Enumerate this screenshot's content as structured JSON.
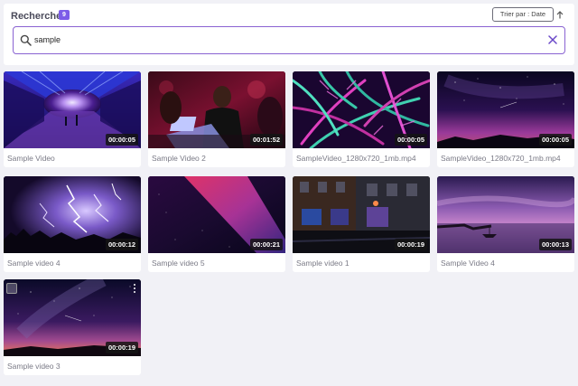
{
  "header": {
    "title": "Recherche",
    "count": "9",
    "sort_label": "Trier par : Date"
  },
  "search": {
    "value": "sample",
    "placeholder": ""
  },
  "videos": [
    {
      "name": "Sample Video",
      "duration": "00:00:05"
    },
    {
      "name": "Sample Video 2",
      "duration": "00:01:52"
    },
    {
      "name": "SampleVideo_1280x720_1mb.mp4",
      "duration": "00:00:05"
    },
    {
      "name": "SampleVideo_1280x720_1mb.mp4",
      "duration": "00:00:05"
    },
    {
      "name": "Sample video 4",
      "duration": "00:00:12"
    },
    {
      "name": "Sample video 5",
      "duration": "00:00:21"
    },
    {
      "name": "Sample video 1",
      "duration": "00:00:19"
    },
    {
      "name": "Sample Video 4",
      "duration": "00:00:13"
    },
    {
      "name": "Sample video 3",
      "duration": "00:00:19"
    }
  ],
  "colors": {
    "accent": "#7c5ce8",
    "search_border": "#8a63d2"
  }
}
